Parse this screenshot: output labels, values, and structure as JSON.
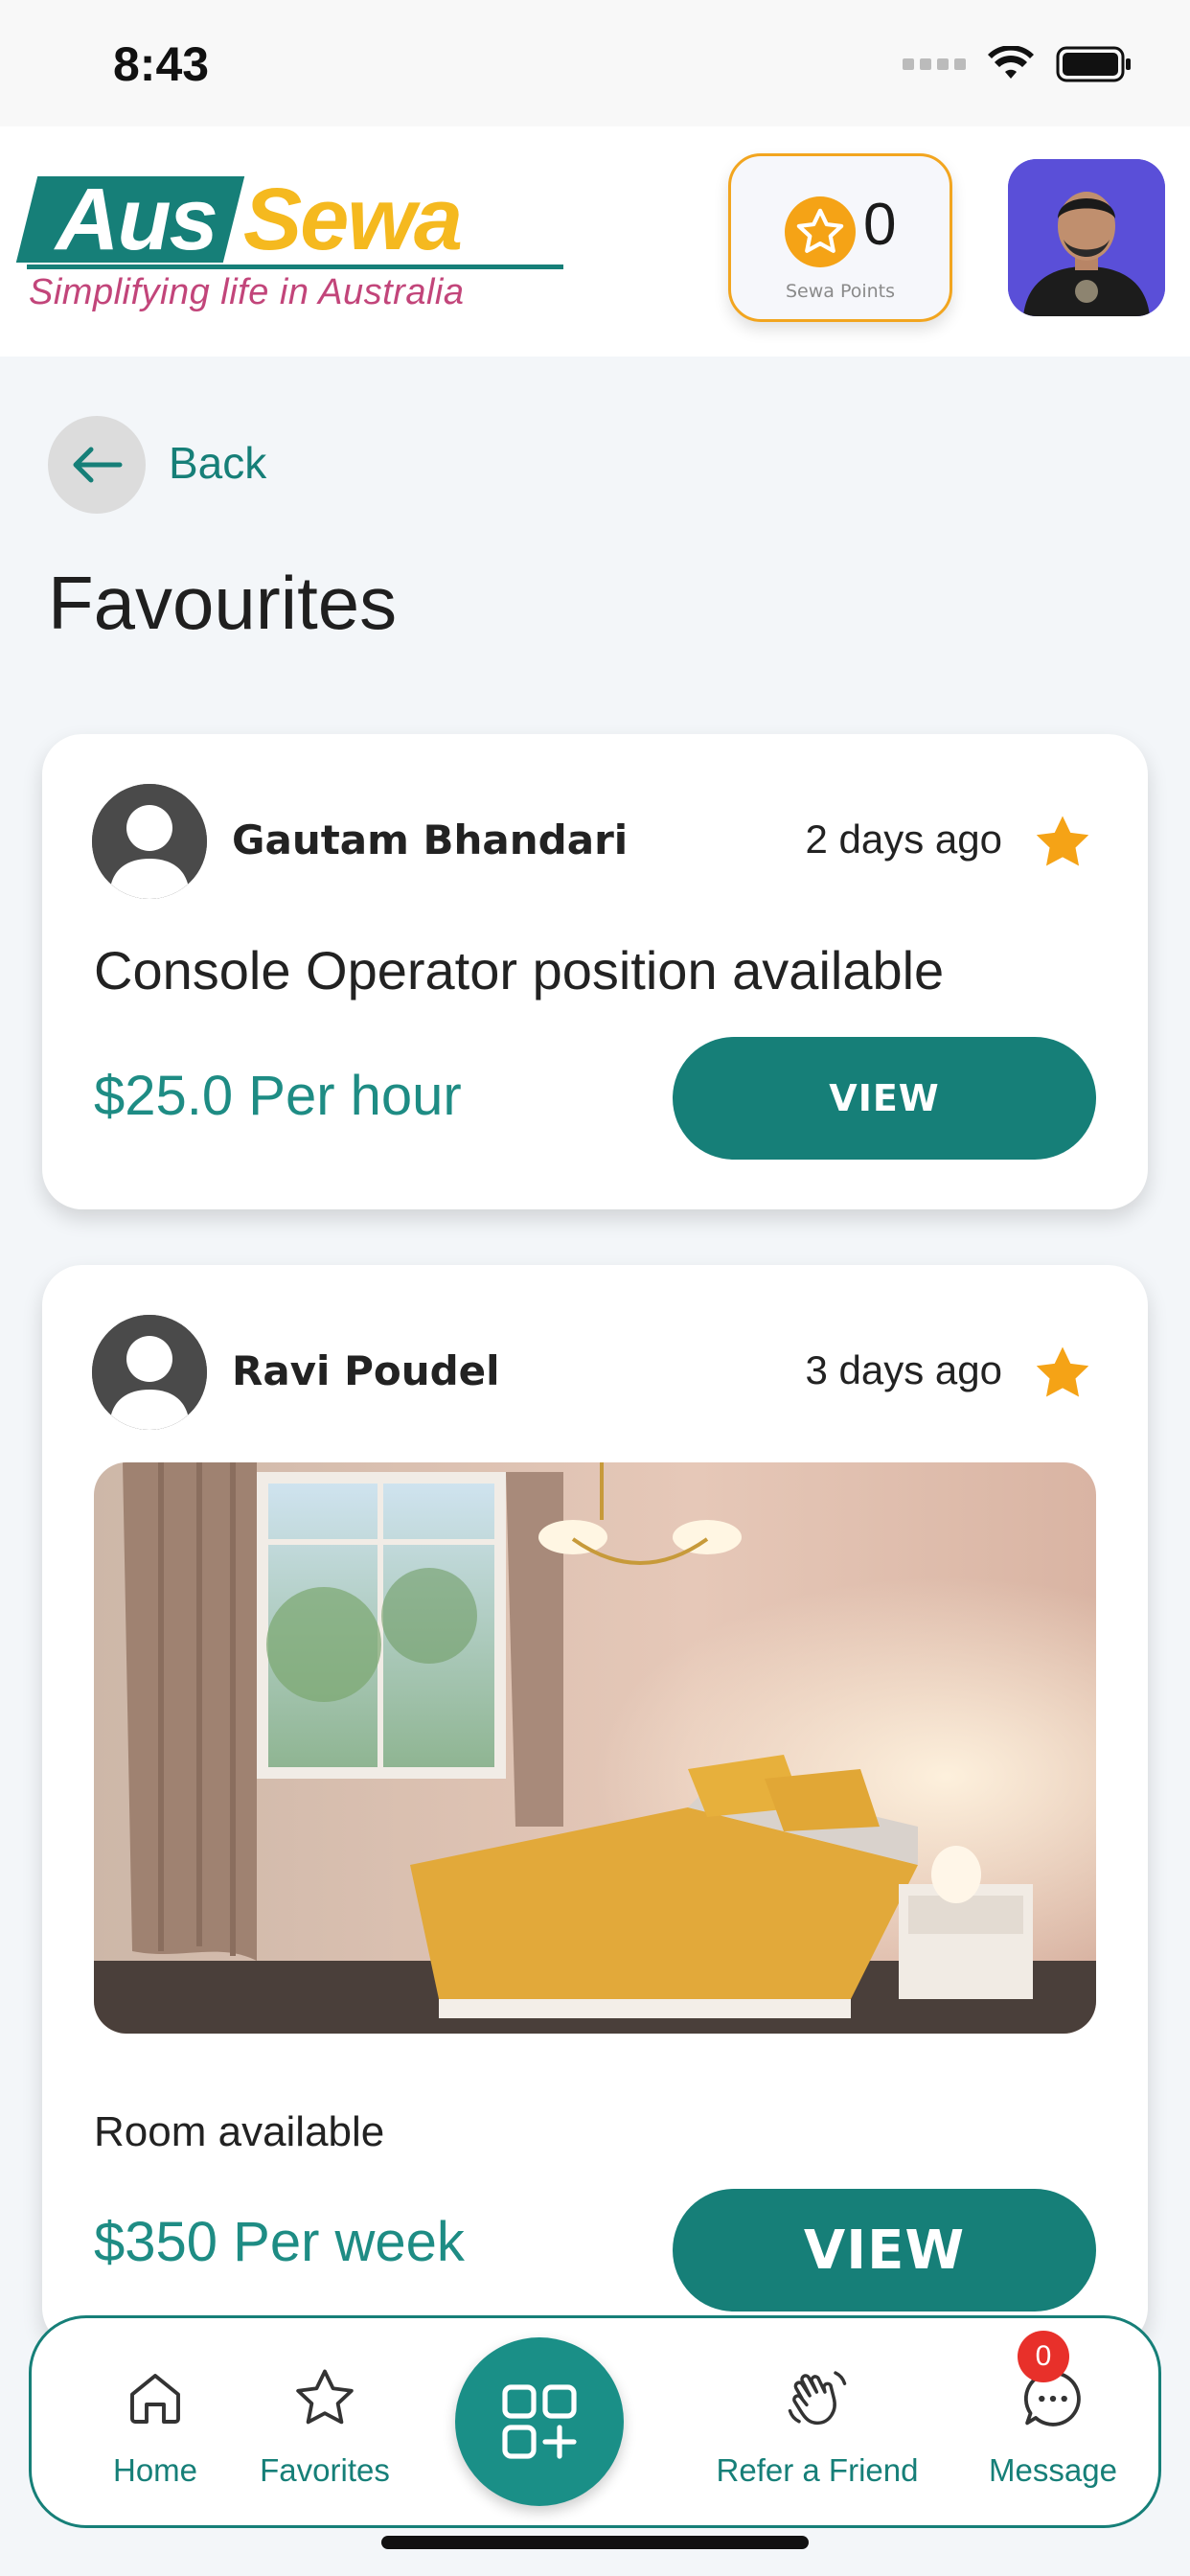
{
  "status_bar": {
    "time": "8:43"
  },
  "header": {
    "logo": {
      "word_1": "Aus",
      "word_2": "Sewa",
      "tagline": "Simplifying life in Australia"
    },
    "points": {
      "value": "0",
      "label": "Sewa Points"
    }
  },
  "nav": {
    "back_label": "Back",
    "page_title": "Favourites"
  },
  "favourites": [
    {
      "name": "Gautam Bhandari",
      "posted": "2 days ago",
      "title": "Console Operator position available",
      "price": "$25.0 Per hour",
      "button": "VIEW",
      "has_image": false
    },
    {
      "name": "Ravi Poudel",
      "posted": "3 days ago",
      "title": "Room available",
      "price": "$350 Per week",
      "button": "VIEW",
      "has_image": true
    }
  ],
  "bottom_nav": {
    "items": [
      {
        "label": "Home",
        "icon": "home-icon"
      },
      {
        "label": "Favorites",
        "icon": "star-outline-icon"
      },
      {
        "label": "Refer a Friend",
        "icon": "waving-hand-icon"
      },
      {
        "label": "Message",
        "icon": "chat-bubble-icon"
      }
    ],
    "center_icon": "add-category-icon",
    "message_badge": "0"
  },
  "colors": {
    "primary": "#167f78",
    "accent": "#f5a316",
    "logo_pink": "#c2457a",
    "logo_yellow": "#f5b91f",
    "badge": "#e8302a"
  }
}
